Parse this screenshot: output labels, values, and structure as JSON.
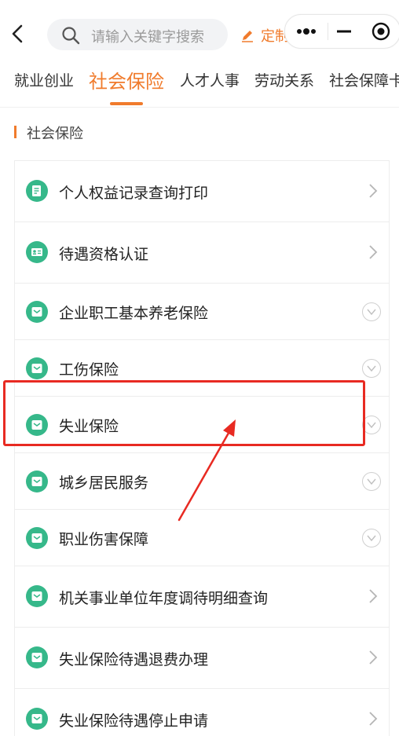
{
  "header": {
    "search_placeholder": "请输入关键字搜索",
    "custom_label": "定制"
  },
  "tabs": [
    {
      "label": "就业创业"
    },
    {
      "label": "社会保险"
    },
    {
      "label": "人才人事"
    },
    {
      "label": "劳动关系"
    },
    {
      "label": "社会保障卡"
    }
  ],
  "active_tab": "社会保险",
  "section": {
    "title": "社会保险"
  },
  "items": [
    {
      "label": "个人权益记录查询打印",
      "icon": "document-icon",
      "trailing": "chevron"
    },
    {
      "label": "待遇资格认证",
      "icon": "id-card-icon",
      "trailing": "chevron"
    },
    {
      "label": "企业职工基本养老保险",
      "icon": "service-icon",
      "trailing": "expand"
    },
    {
      "label": "工伤保险",
      "icon": "service-icon",
      "trailing": "expand"
    },
    {
      "label": "失业保险",
      "icon": "service-icon",
      "trailing": "expand"
    },
    {
      "label": "城乡居民服务",
      "icon": "service-icon",
      "trailing": "expand"
    },
    {
      "label": "职业伤害保障",
      "icon": "service-icon",
      "trailing": "expand"
    },
    {
      "label": "机关事业单位年度调待明细查询",
      "icon": "service-icon",
      "trailing": "chevron"
    },
    {
      "label": "失业保险待遇退费办理",
      "icon": "service-icon",
      "trailing": "chevron"
    },
    {
      "label": "失业保险待遇停止申请",
      "icon": "service-icon",
      "trailing": "chevron"
    }
  ],
  "colors": {
    "accent": "#f07b2c",
    "icon_bg": "#36b88a",
    "highlight": "#e82a22"
  }
}
